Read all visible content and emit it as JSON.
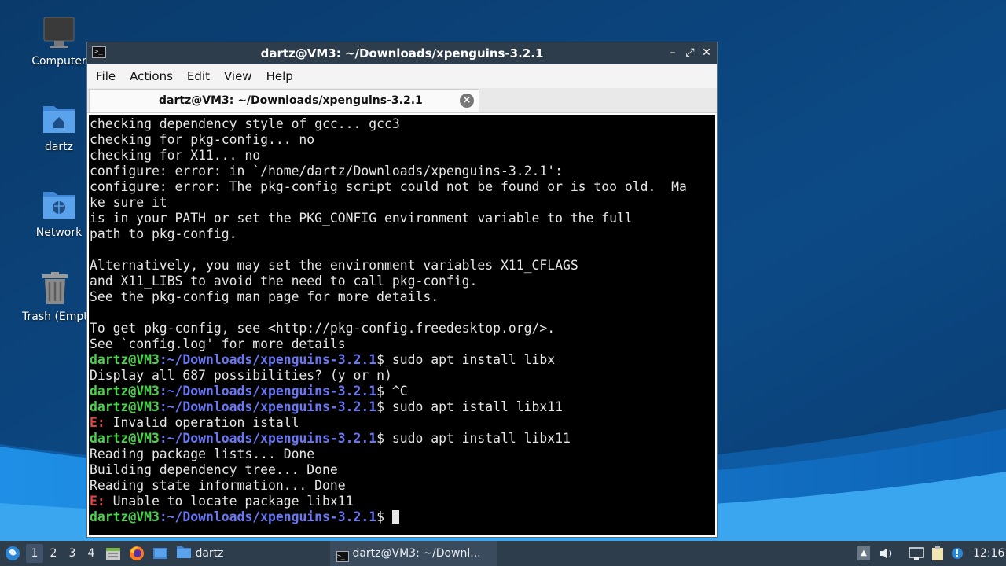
{
  "desktop": {
    "icons": [
      {
        "label": "Computer",
        "icon": "monitor-icon"
      },
      {
        "label": "dartz",
        "icon": "home-folder-icon"
      },
      {
        "label": "Network",
        "icon": "network-folder-icon"
      },
      {
        "label": "Trash (Empty)",
        "icon": "trash-icon"
      }
    ]
  },
  "window": {
    "title": "dartz@VM3: ~/Downloads/xpenguins-3.2.1",
    "menu": [
      "File",
      "Actions",
      "Edit",
      "View",
      "Help"
    ],
    "tab_label": "dartz@VM3: ~/Downloads/xpenguins-3.2.1",
    "terminal": {
      "prompt_user": "dartz@VM3",
      "prompt_path": "~/Downloads/xpenguins-3.2.1",
      "prompt_sep": ":",
      "prompt_end": "$ ",
      "lines": [
        {
          "kind": "out",
          "text": "checking dependency style of gcc... gcc3"
        },
        {
          "kind": "out",
          "text": "checking for pkg-config... no"
        },
        {
          "kind": "out",
          "text": "checking for X11... no"
        },
        {
          "kind": "out",
          "text": "configure: error: in `/home/dartz/Downloads/xpenguins-3.2.1':"
        },
        {
          "kind": "out",
          "text": "configure: error: The pkg-config script could not be found or is too old.  Ma"
        },
        {
          "kind": "out",
          "text": "ke sure it"
        },
        {
          "kind": "out",
          "text": "is in your PATH or set the PKG_CONFIG environment variable to the full"
        },
        {
          "kind": "out",
          "text": "path to pkg-config."
        },
        {
          "kind": "out",
          "text": ""
        },
        {
          "kind": "out",
          "text": "Alternatively, you may set the environment variables X11_CFLAGS"
        },
        {
          "kind": "out",
          "text": "and X11_LIBS to avoid the need to call pkg-config."
        },
        {
          "kind": "out",
          "text": "See the pkg-config man page for more details."
        },
        {
          "kind": "out",
          "text": ""
        },
        {
          "kind": "out",
          "text": "To get pkg-config, see <http://pkg-config.freedesktop.org/>."
        },
        {
          "kind": "out",
          "text": "See `config.log' for more details"
        },
        {
          "kind": "cmd",
          "text": "sudo apt install libx"
        },
        {
          "kind": "out",
          "text": "Display all 687 possibilities? (y or n)"
        },
        {
          "kind": "cmd",
          "text": "^C"
        },
        {
          "kind": "cmd",
          "text": "sudo apt istall libx11"
        },
        {
          "kind": "err",
          "label": "E:",
          "text": " Invalid operation istall"
        },
        {
          "kind": "cmd",
          "text": "sudo apt install libx11"
        },
        {
          "kind": "out",
          "text": "Reading package lists... Done"
        },
        {
          "kind": "out",
          "text": "Building dependency tree... Done"
        },
        {
          "kind": "out",
          "text": "Reading state information... Done"
        },
        {
          "kind": "err",
          "label": "E:",
          "text": " Unable to locate package libx11"
        },
        {
          "kind": "cmd",
          "text": "",
          "cursor": true
        }
      ]
    }
  },
  "taskbar": {
    "workspaces": [
      "1",
      "2",
      "3",
      "4"
    ],
    "active_workspace": "1",
    "folder_button": "dartz",
    "window_button": "dartz@VM3: ~/Downl...",
    "clock": "12:16"
  },
  "colors": {
    "taskbar": "#2e3d4c",
    "prompt_user": "#4bd14b",
    "prompt_path": "#6a77f5",
    "error": "#e04545"
  }
}
